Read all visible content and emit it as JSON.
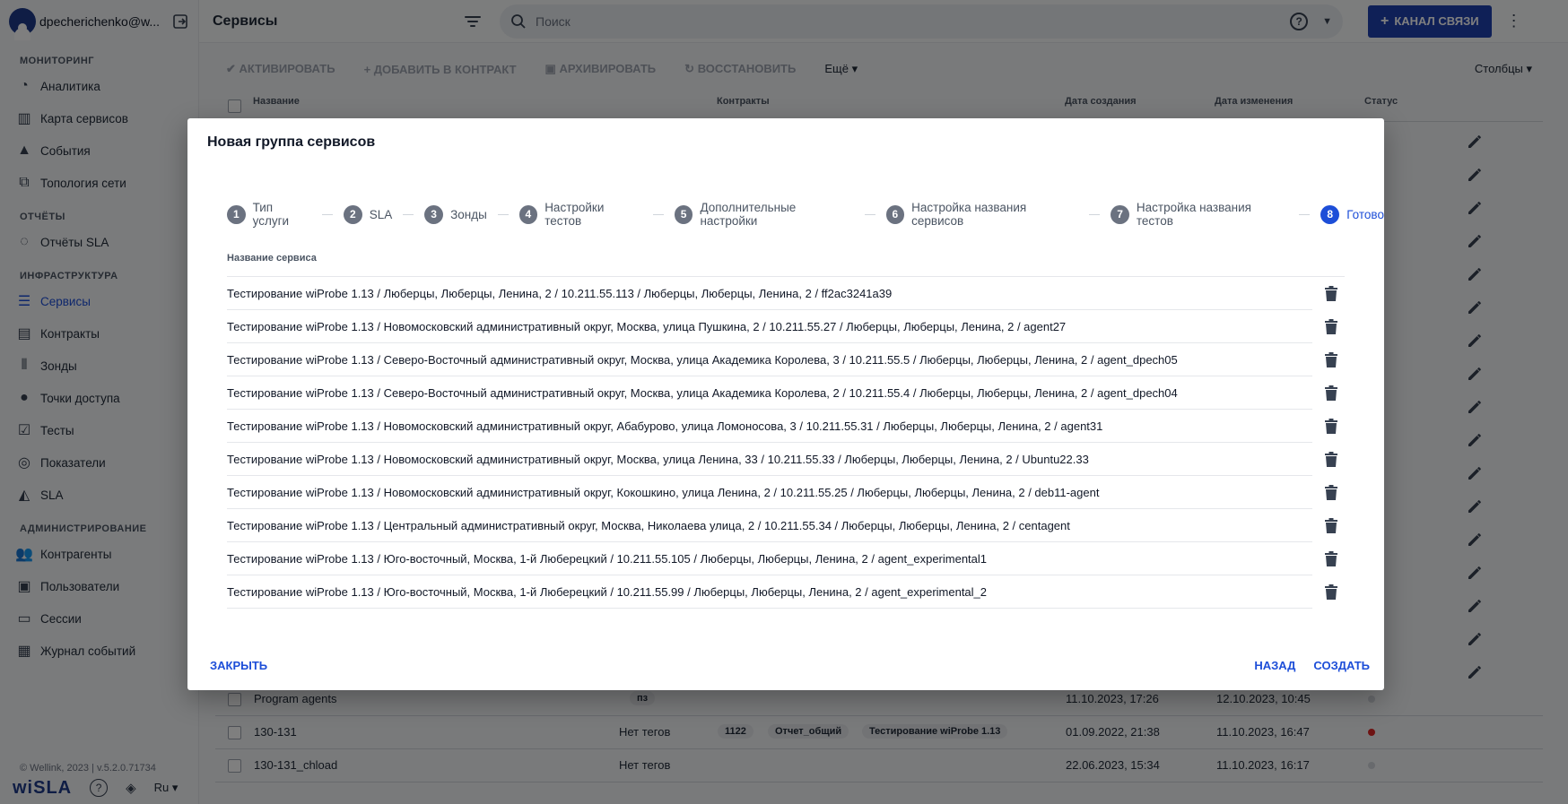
{
  "user": {
    "name": "dpecherichenko@w..."
  },
  "sidebar": {
    "sections": [
      {
        "title": "МОНИТОРИНГ",
        "items": [
          "Аналитика",
          "Карта сервисов",
          "События",
          "Топология сети"
        ]
      },
      {
        "title": "ОТЧЁТЫ",
        "items": [
          "Отчёты SLA"
        ]
      },
      {
        "title": "ИНФРАСТРУКТУРА",
        "items": [
          "Сервисы",
          "Контракты",
          "Зонды",
          "Точки доступа",
          "Тесты",
          "Показатели",
          "SLA"
        ]
      },
      {
        "title": "АДМИНИСТРИРОВАНИЕ",
        "items": [
          "Контрагенты",
          "Пользователи",
          "Сессии",
          "Журнал событий"
        ]
      }
    ],
    "active_item": "Сервисы",
    "copyright": "© Wellink, 2023 | v.5.2.0.71734",
    "logo": "wiSLA",
    "language": "Ru"
  },
  "topbar": {
    "title": "Сервисы",
    "search_placeholder": "Поиск",
    "channel_button": "КАНАЛ СВЯЗИ"
  },
  "toolbar": {
    "activate": "АКТИВИРОВАТЬ",
    "add_to_contract": "ДОБАВИТЬ В КОНТРАКТ",
    "archive": "АРХИВИРОВАТЬ",
    "restore": "ВОССТАНОВИТЬ",
    "more": "Ещё",
    "columns": "Столбцы"
  },
  "table": {
    "headers": {
      "name": "Название",
      "contracts": "Контракты",
      "created": "Дата создания",
      "modified": "Дата изменения",
      "status": "Статус"
    },
    "rows": [
      {
        "name": "Program agents",
        "tags_label": "пз",
        "contracts": [],
        "created": "11.10.2023, 17:26",
        "modified": "12.10.2023, 10:45",
        "status_color": "#d1d5db"
      },
      {
        "name": "130-131",
        "tags_label": "Нет тегов",
        "contracts": [
          "1122",
          "Отчет_общий",
          "Тестирование wiProbe 1.13"
        ],
        "created": "01.09.2022, 21:38",
        "modified": "11.10.2023, 16:47",
        "status_color": "#dc2626"
      },
      {
        "name": "130-131_chload",
        "tags_label": "Нет тегов",
        "contracts": [],
        "created": "22.06.2023, 15:34",
        "modified": "11.10.2023, 16:17",
        "status_color": "#d1d5db"
      }
    ]
  },
  "modal": {
    "title": "Новая группа сервисов",
    "steps": [
      {
        "num": "1",
        "label": "Тип услуги"
      },
      {
        "num": "2",
        "label": "SLA"
      },
      {
        "num": "3",
        "label": "Зонды"
      },
      {
        "num": "4",
        "label": "Настройки тестов"
      },
      {
        "num": "5",
        "label": "Дополнительные настройки"
      },
      {
        "num": "6",
        "label": "Настройка названия сервисов"
      },
      {
        "num": "7",
        "label": "Настройка названия тестов"
      },
      {
        "num": "8",
        "label": "Готово"
      }
    ],
    "current_step": 8,
    "column_header": "Название сервиса",
    "services": [
      "Тестирование wiProbe 1.13 / Люберцы, Люберцы, Ленина, 2 / 10.211.55.113 / Люберцы, Люберцы, Ленина, 2 / ff2ac3241a39",
      "Тестирование wiProbe 1.13 / Новомосковский административный округ, Москва, улица Пушкина, 2 / 10.211.55.27 / Люберцы, Люберцы, Ленина, 2 / agent27",
      "Тестирование wiProbe 1.13 / Северо-Восточный административный округ, Москва, улица Академика Королева, 3 / 10.211.55.5 / Люберцы, Люберцы, Ленина, 2 / agent_dpech05",
      "Тестирование wiProbe 1.13 / Северо-Восточный административный округ, Москва, улица Академика Королева, 2 / 10.211.55.4 / Люберцы, Люберцы, Ленина, 2 / agent_dpech04",
      "Тестирование wiProbe 1.13 / Новомосковский административный округ, Абабурово, улица Ломоносова, 3 / 10.211.55.31 / Люберцы, Люберцы, Ленина, 2 / agent31",
      "Тестирование wiProbe 1.13 / Новомосковский административный округ, Москва, улица Ленина, 33 / 10.211.55.33 / Люберцы, Люберцы, Ленина, 2 / Ubuntu22.33",
      "Тестирование wiProbe 1.13 / Новомосковский административный округ, Кокошкино, улица Ленина, 2 / 10.211.55.25 / Люберцы, Люберцы, Ленина, 2 / deb11-agent",
      "Тестирование wiProbe 1.13 / Центральный административный округ, Москва, Николаева улица, 2 / 10.211.55.34 / Люберцы, Люберцы, Ленина, 2 / centagent",
      "Тестирование wiProbe 1.13 / Юго-восточный, Москва, 1-й Люберецкий / 10.211.55.105 / Люберцы, Люберцы, Ленина, 2 / agent_experimental1",
      "Тестирование wiProbe 1.13 / Юго-восточный, Москва, 1-й Люберецкий / 10.211.55.99 / Люберцы, Люберцы, Ленина, 2 / agent_experimental_2"
    ],
    "close_label": "ЗАКРЫТЬ",
    "back_label": "НАЗАД",
    "create_label": "СОЗДАТЬ"
  }
}
